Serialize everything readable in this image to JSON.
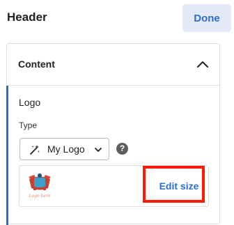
{
  "header": {
    "title": "Header",
    "done_label": "Done"
  },
  "panel": {
    "title": "Content",
    "collapse_icon": "chevron-up-icon",
    "section_label": "Logo",
    "type_label": "Type",
    "type_select": {
      "value": "My Logo",
      "icon": "magic-wand-icon",
      "dropdown_icon": "chevron-down-icon"
    },
    "help_icon": "question-circle-icon",
    "help_glyph": "?",
    "logo_preview": {
      "icon": "logo-thumbnail-icon",
      "text": "Logo here"
    },
    "edit_size_label": "Edit size"
  },
  "colors": {
    "accent": "#2c6ecb",
    "done_bg": "#e4e9f7",
    "highlight": "#ff1a00"
  }
}
